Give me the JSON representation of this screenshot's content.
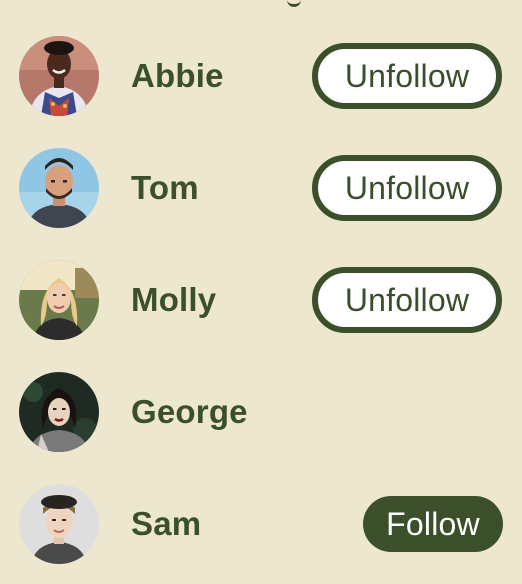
{
  "users": [
    {
      "name": "Abbie",
      "button": "Unfollow"
    },
    {
      "name": "Tom",
      "button": "Unfollow"
    },
    {
      "name": "Molly",
      "button": "Unfollow"
    },
    {
      "name": "George",
      "button": ""
    },
    {
      "name": "Sam",
      "button": "Follow"
    }
  ],
  "colors": {
    "background": "#ede7cf",
    "accent": "#3a4f2a",
    "unfollow_bg": "#ffffff"
  }
}
